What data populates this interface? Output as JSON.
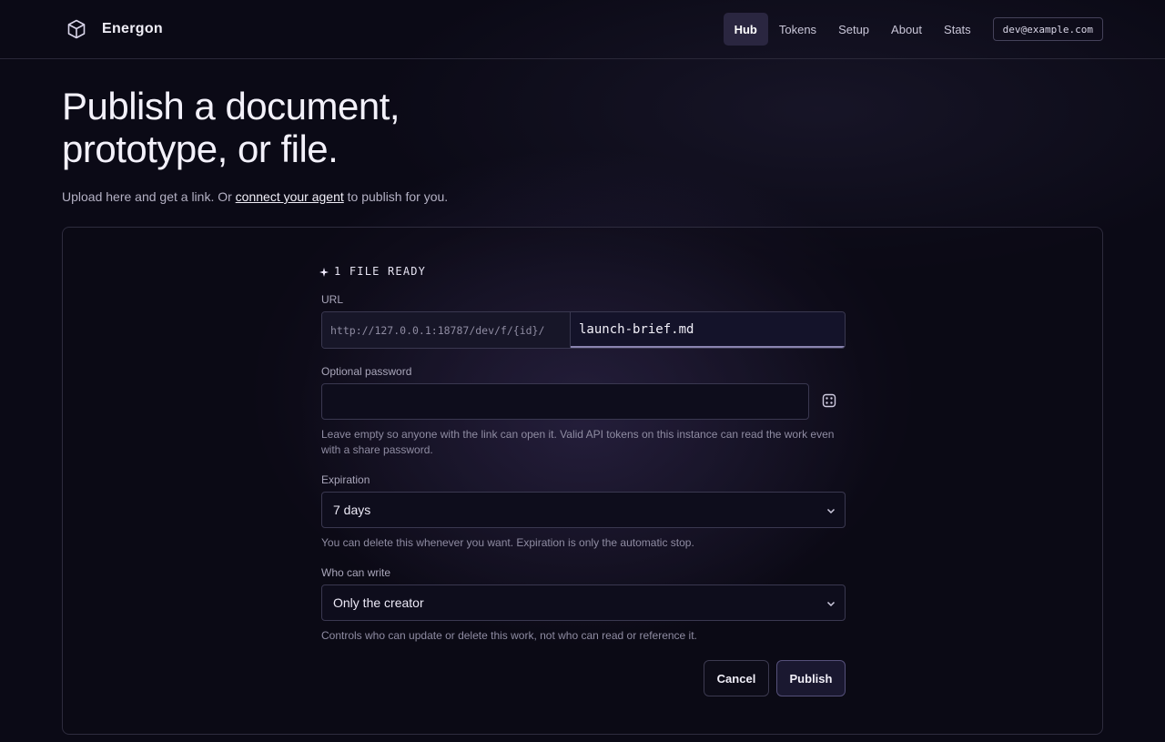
{
  "header": {
    "brand": "Energon",
    "nav": [
      {
        "label": "Hub",
        "active": true
      },
      {
        "label": "Tokens",
        "active": false
      },
      {
        "label": "Setup",
        "active": false
      },
      {
        "label": "About",
        "active": false
      },
      {
        "label": "Stats",
        "active": false
      }
    ],
    "user_email": "dev@example.com"
  },
  "hero": {
    "title_line1": "Publish a document,",
    "title_line2": "prototype, or file.",
    "subtitle_before": "Upload here and get a link. Or ",
    "subtitle_link": "connect your agent",
    "subtitle_after": " to publish for you."
  },
  "form": {
    "status": "1 FILE READY",
    "url_label": "URL",
    "url_prefix": "http://127.0.0.1:18787/dev/f/{id}/",
    "url_value": "launch-brief.md",
    "password_label": "Optional password",
    "password_value": "",
    "password_hint": "Leave empty so anyone with the link can open it. Valid API tokens on this instance can read the work even with a share password.",
    "expiration_label": "Expiration",
    "expiration_value": "7 days",
    "expiration_hint": "You can delete this whenever you want. Expiration is only the automatic stop.",
    "write_label": "Who can write",
    "write_value": "Only the creator",
    "write_hint": "Controls who can update or delete this work, not who can read or reference it.",
    "cancel_label": "Cancel",
    "publish_label": "Publish"
  },
  "colors": {
    "background": "#0b0a16",
    "active_nav": "#2a2640",
    "border": "#3a3850"
  }
}
